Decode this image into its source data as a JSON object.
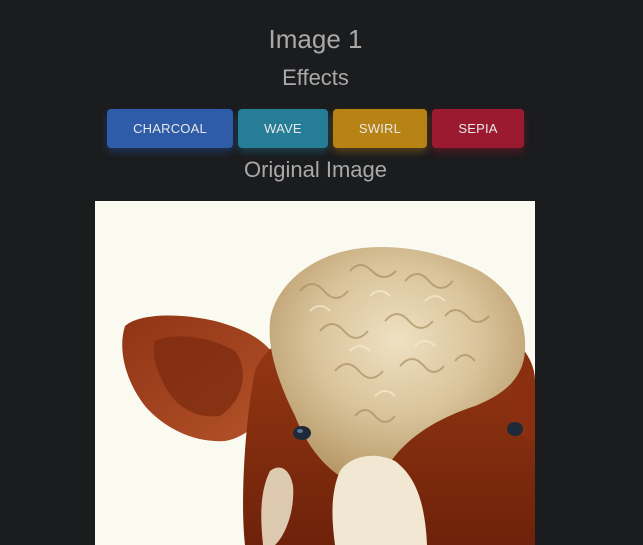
{
  "page": {
    "title": "Image 1",
    "effects_heading": "Effects",
    "original_heading": "Original Image"
  },
  "effects": {
    "buttons": [
      {
        "label": "CHARCOAL",
        "color": "#2f5ca8"
      },
      {
        "label": "WAVE",
        "color": "#257d96"
      },
      {
        "label": "SWIRL",
        "color": "#b78314"
      },
      {
        "label": "SEPIA",
        "color": "#9c1a30"
      }
    ]
  },
  "image": {
    "subject": "photo of a brown and white cow with curly cream-colored forelock",
    "background_color": "#fbfaf1"
  }
}
